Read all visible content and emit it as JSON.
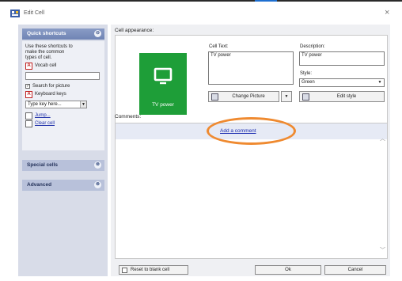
{
  "window": {
    "title": "Edit Cell",
    "close_glyph": "×"
  },
  "sidebar": {
    "quick_shortcuts": {
      "title": "Quick shortcuts",
      "toggle": "⊖",
      "description_lines": [
        "Use these shortcuts to",
        "make the common",
        "types of cell."
      ],
      "vocab_cell": "Vocab cell",
      "search_for_picture": "Search for picture",
      "keyboard_keys": "Keyboard keys",
      "keyboard_select": "Type key here...",
      "jump": "Jump...",
      "clear_cell": "Clear cell"
    },
    "special_cells": {
      "title": "Special cells",
      "toggle": "⊗"
    },
    "advanced": {
      "title": "Advanced",
      "toggle": "⊗"
    }
  },
  "appearance": {
    "section_label": "Cell appearance:",
    "tile_label": "TV power",
    "cell_text_label": "Cell Text:",
    "cell_text_value": "TV power",
    "description_label": "Description:",
    "description_value": "TV power",
    "style_label": "Style:",
    "style_value": "Green",
    "change_picture": "Change Picture",
    "edit_style": "Edit style"
  },
  "comments": {
    "section_label": "Comments:",
    "add_comment": "Add a comment",
    "scroll_up": "︿",
    "scroll_down": "﹀"
  },
  "footer": {
    "reset": "Reset to blank cell",
    "ok": "Ok",
    "cancel": "Cancel"
  },
  "colors": {
    "tile_green": "#1e9e38",
    "panel_header": "#7a8fc0",
    "highlight": "#ef8a30",
    "link": "#1a2bb0"
  }
}
